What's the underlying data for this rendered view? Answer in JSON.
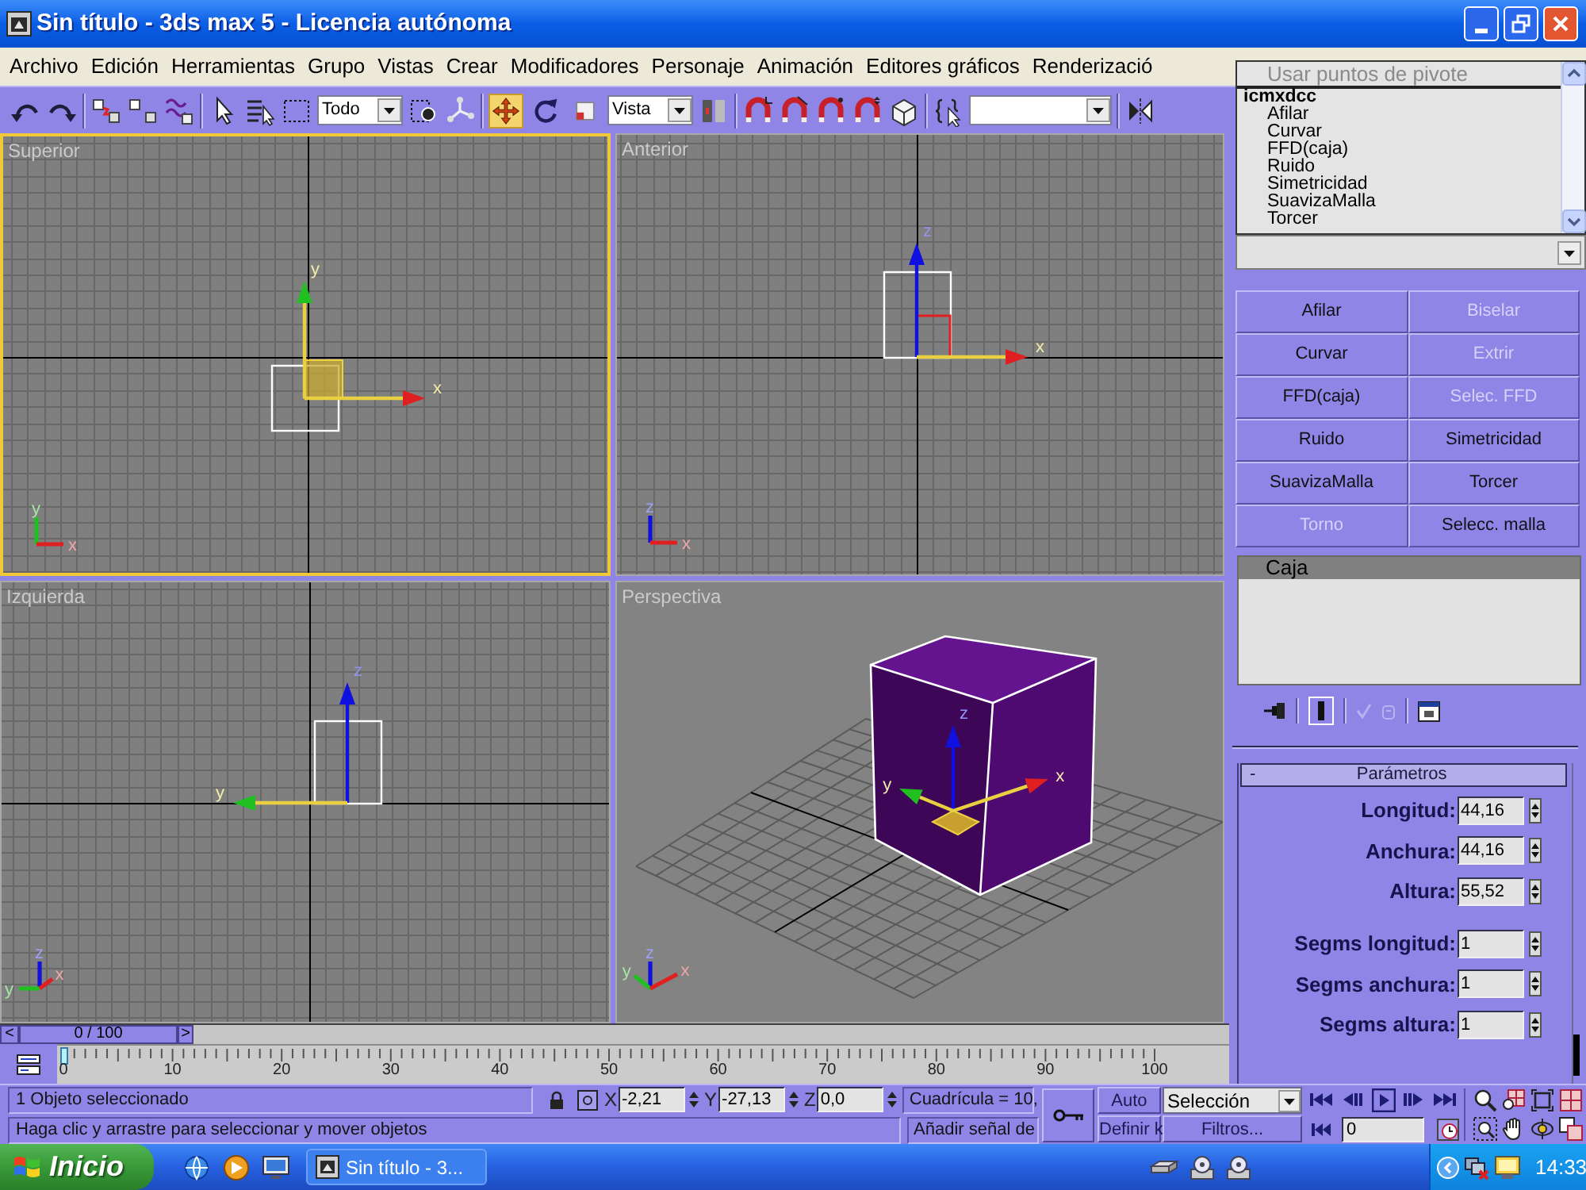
{
  "window": {
    "title": "Sin título - 3ds max 5 - Licencia autónoma"
  },
  "menu_bar": [
    "Archivo",
    "Edición",
    "Herramientas",
    "Grupo",
    "Vistas",
    "Crear",
    "Modificadores",
    "Personaje",
    "Animación",
    "Editores gráficos",
    "Renderizació"
  ],
  "toolbar": {
    "selection_filter": "Todo",
    "tools": [
      {
        "kind": "move",
        "selected": true
      },
      {
        "kind": "rotate",
        "selected": false
      },
      {
        "kind": "scale",
        "selected": false
      }
    ],
    "coordinate_system": "Vista"
  },
  "viewports": [
    {
      "label": "Superior",
      "kind": "top",
      "selected": true,
      "gizmo_axes": [
        {
          "label": "y",
          "color": "#20c020",
          "active": true
        },
        {
          "label": "x",
          "color": "#e02020",
          "active": true
        }
      ],
      "corner_axes": [
        {
          "label": "y",
          "color": "#20c020"
        },
        {
          "label": "x",
          "color": "#e02020"
        }
      ]
    },
    {
      "label": "Anterior",
      "kind": "front",
      "selected": false,
      "gizmo_axes": [
        {
          "label": "z",
          "color": "#1010e0",
          "active": false
        },
        {
          "label": "x",
          "color": "#e02020",
          "active": true
        }
      ],
      "corner_axes": [
        {
          "label": "z",
          "color": "#1010e0"
        },
        {
          "label": "x",
          "color": "#e02020"
        }
      ]
    },
    {
      "label": "Izquierda",
      "kind": "left",
      "selected": false,
      "gizmo_axes": [
        {
          "label": "z",
          "color": "#1010e0",
          "active": false
        },
        {
          "label": "y",
          "color": "#20c020",
          "active": true
        }
      ],
      "corner_axes": [
        {
          "label": "z",
          "color": "#1010e0"
        },
        {
          "label": "y",
          "color": "#20c020"
        },
        {
          "label": "x",
          "color": "#e02020"
        }
      ]
    },
    {
      "label": "Perspectiva",
      "kind": "perspective",
      "selected": false,
      "gizmo_axes": [
        {
          "label": "z",
          "color": "#1010e0",
          "active": false
        },
        {
          "label": "y",
          "color": "#20c020",
          "active": true
        },
        {
          "label": "x",
          "color": "#e02020",
          "active": true
        }
      ],
      "corner_axes": [
        {
          "label": "z",
          "color": "#1010e0"
        },
        {
          "label": "y",
          "color": "#20c020"
        },
        {
          "label": "x",
          "color": "#e02020"
        }
      ]
    }
  ],
  "dropdown": {
    "header": {
      "label": "Usar puntos de pivote",
      "disabled": true
    },
    "items": [
      {
        "label": "icmxdcc",
        "kind": "group"
      },
      {
        "label": "Afilar",
        "kind": "item"
      },
      {
        "label": "Curvar",
        "kind": "item"
      },
      {
        "label": "FFD(caja)",
        "kind": "item"
      },
      {
        "label": "Ruido",
        "kind": "item"
      },
      {
        "label": "Simetricidad",
        "kind": "item"
      },
      {
        "label": "SuavizaMalla",
        "kind": "item"
      },
      {
        "label": "Torcer",
        "kind": "item"
      }
    ]
  },
  "modifier_buttons": [
    {
      "label": "Afilar",
      "disabled": false
    },
    {
      "label": "Biselar",
      "disabled": true
    },
    {
      "label": "Curvar",
      "disabled": false
    },
    {
      "label": "Extrir",
      "disabled": true
    },
    {
      "label": "FFD(caja)",
      "disabled": false
    },
    {
      "label": "Selec. FFD",
      "disabled": true
    },
    {
      "label": "Ruido",
      "disabled": false
    },
    {
      "label": "Simetricidad",
      "disabled": false
    },
    {
      "label": "SuavizaMalla",
      "disabled": false
    },
    {
      "label": "Torcer",
      "disabled": false
    },
    {
      "label": "Torno",
      "disabled": true
    },
    {
      "label": "Selecc. malla",
      "disabled": false
    }
  ],
  "modifier_stack": [
    {
      "label": "Caja",
      "selected": true
    }
  ],
  "parameters": {
    "toggle": "-",
    "title": "Parámetros",
    "size_fields": [
      {
        "label": "Longitud:",
        "value": "44,16"
      },
      {
        "label": "Anchura:",
        "value": "44,16"
      },
      {
        "label": "Altura:",
        "value": "55,52"
      }
    ],
    "segment_fields": [
      {
        "label": "Segms longitud:",
        "value": "1"
      },
      {
        "label": "Segms anchura:",
        "value": "1"
      },
      {
        "label": "Segms altura:",
        "value": "1"
      }
    ]
  },
  "time_slider": {
    "previous": "<",
    "position": "0 / 100",
    "next": ">"
  },
  "track_bar": {
    "ticks": [
      "0",
      "10",
      "20",
      "30",
      "40",
      "50",
      "60",
      "70",
      "80",
      "90",
      "100"
    ]
  },
  "status_bar": {
    "selection": "1 Objeto seleccionado",
    "coordinates": [
      {
        "axis": "X",
        "value": "-2,21"
      },
      {
        "axis": "Y",
        "value": "-27,13"
      },
      {
        "axis": "Z",
        "value": "0,0"
      }
    ],
    "grid": "Cuadrícula = 10,",
    "prompt": "Haga clic y arrastre para seleccionar y mover objetos",
    "time_tag": "Añadir señal de"
  },
  "animation_controls": {
    "auto_key": "Auto",
    "set_key": "Definir k",
    "key_filter": "Selección",
    "filters": "Filtros...",
    "frame": "0"
  },
  "taskbar": {
    "start": "Inicio",
    "task": "Sin título - 3...",
    "clock": "14:33"
  }
}
